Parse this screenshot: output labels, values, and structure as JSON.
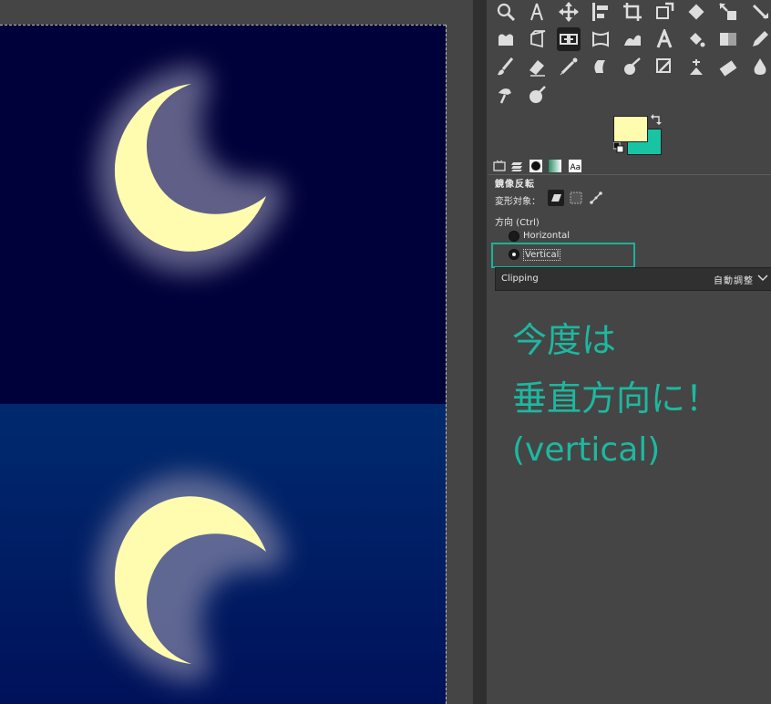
{
  "canvas": {
    "top_sky_color": "#00003a",
    "bottom_sky_top_color": "#002a6e",
    "bottom_sky_bottom_color": "#00115a",
    "moon_color": "#fffcb0"
  },
  "toolbox": {
    "rows": [
      [
        "search-icon",
        "fuzzy-select-icon",
        "move-icon",
        "align-icon",
        "crop-icon",
        "unified-transform-icon",
        "rotate-icon",
        "scale-icon",
        "shear-icon"
      ],
      [
        "cage-transform-icon",
        "perspective-icon",
        "flip-icon",
        "warp-icon",
        "smudge-wave-icon",
        "text-icon",
        "bucket-fill-icon",
        "gradient-icon",
        "pencil-icon"
      ],
      [
        "paintbrush-icon",
        "eraser-icon",
        "airbrush-icon",
        "ink-icon",
        "mypaint-brush-icon",
        "clone-icon",
        "heal-icon",
        "perspective-clone-icon",
        "blur-icon"
      ],
      [
        "dodge-icon",
        "color-picker-icon"
      ]
    ],
    "active_tool": "flip-icon"
  },
  "colors": {
    "foreground": "#fffcb0",
    "background": "#19c4a4"
  },
  "tool_options": {
    "title": "鏡像反転",
    "transform_label": "変形対象：",
    "direction_label": "方向 (Ctrl)",
    "directions": [
      {
        "label": "Horizontal",
        "checked": false
      },
      {
        "label": "Vertical",
        "checked": true
      }
    ],
    "clipping_label": "Clipping",
    "clipping_value": "自動調整"
  },
  "annotation": {
    "line1": "今度は",
    "line2": "垂直方向に！",
    "line3": "(vertical)",
    "color": "#1db8a0"
  }
}
